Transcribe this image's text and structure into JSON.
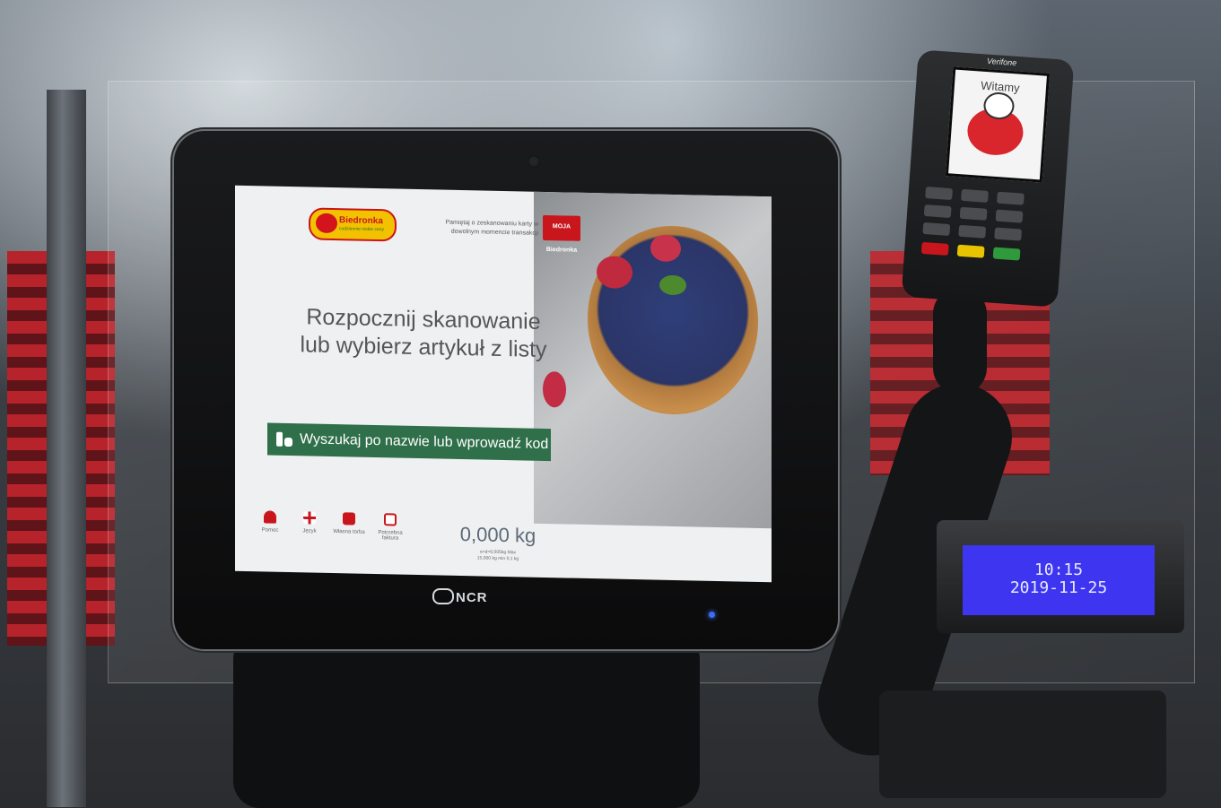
{
  "kiosk_screen": {
    "brand": "Biedronka",
    "brand_tagline": "codziennie niskie ceny",
    "reminder": "Pamiętaj o zeskanowaniu karty w dowolnym momencie transakcji",
    "loyalty_card": "MOJA Biedronka",
    "headline_line1": "Rozpocznij skanowanie",
    "headline_line2": "lub wybierz artykuł z listy",
    "search_button": "Wyszukaj po nazwie lub wprowadź kod",
    "bottom_menu": [
      {
        "label": "Pomoc",
        "icon": "person-icon"
      },
      {
        "label": "Język",
        "icon": "uk-flag-icon"
      },
      {
        "label": "Własna torba",
        "icon": "bag-icon"
      },
      {
        "label": "Potrzebna faktura",
        "icon": "invoice-icon"
      }
    ],
    "weight": "0,000 kg",
    "weight_note_line1": "e=d=0,005kg Max",
    "weight_note_line2": "15,000 kg min 0,1 kg"
  },
  "monitor_brand": "NCR",
  "payment_terminal": {
    "brand": "Verifone",
    "greeting": "Witamy"
  },
  "customer_display": {
    "time": "10:15",
    "date": "2019-11-25"
  },
  "colors": {
    "brand_red": "#c9161d",
    "brand_yellow": "#f2c200",
    "search_green": "#2f6f4a",
    "display_blue": "#3d35f0"
  }
}
